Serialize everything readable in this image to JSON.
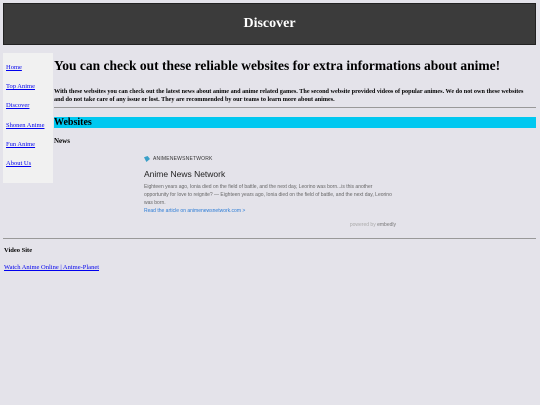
{
  "header": {
    "title": "Discover"
  },
  "sidebar": {
    "items": [
      {
        "label": "Home"
      },
      {
        "label": "Top Anime"
      },
      {
        "label": "Discover"
      },
      {
        "label": "Shonen Anime"
      },
      {
        "label": "Fun Anime"
      },
      {
        "label": "About Us"
      }
    ]
  },
  "main": {
    "heading": "You can check out these reliable websites for extra informations about anime!",
    "intro": "With these websites you can check out the latest news about anime and anime related games. The second website provided videos of popular animes. We do not own these websites and do not take care of any issue or lost. They are recommended by our teams to learn more about animes.",
    "websites_label": "Websites",
    "news_label": "News"
  },
  "embed": {
    "provider": "ANIMENEWSNETWORK",
    "title": "Anime News Network",
    "description": "Eighteen years ago, Ionia died on the field of battle, and the next day, Leorino was born...is this another opportunity for love to reignite? — Eighteen years ago, Ionia died on the field of battle, and the next day, Leorino was born.",
    "read_more": "Read the article on animenewsnetwork.com >",
    "powered_prefix": "powered by",
    "powered_brand": "embedly"
  },
  "video": {
    "label": "Video Site",
    "link": "Watch Anime Online | Anime-Planet"
  },
  "colors": {
    "header_bg": "#3b3b3b",
    "page_bg": "#e4e3ea",
    "websites_bar": "#00c8f0",
    "link": "#0000ee"
  }
}
